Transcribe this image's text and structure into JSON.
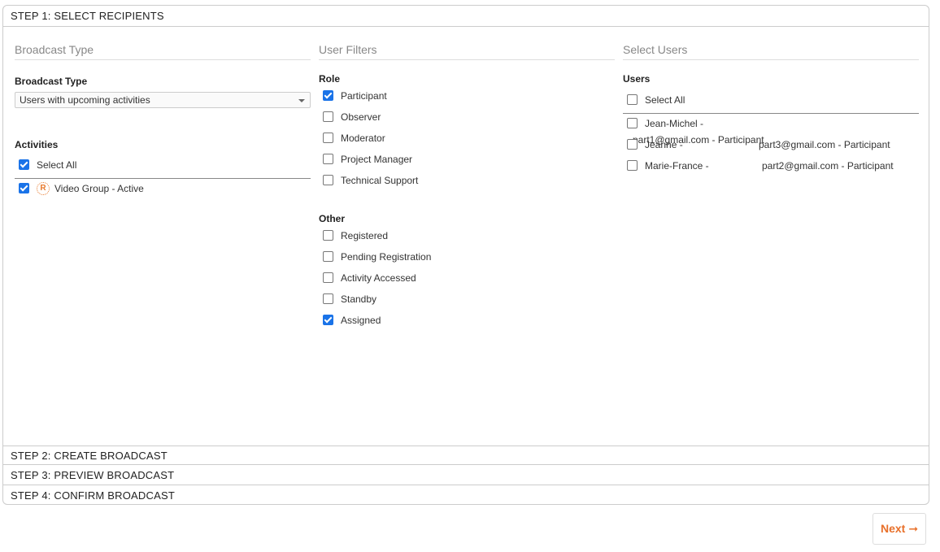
{
  "steps": {
    "step1": "STEP 1: SELECT RECIPIENTS",
    "step2": "STEP 2: CREATE BROADCAST",
    "step3": "STEP 3: PREVIEW BROADCAST",
    "step4": "STEP 4: CONFIRM BROADCAST"
  },
  "broadcast": {
    "section_title": "Broadcast Type",
    "label": "Broadcast Type",
    "selected": "Users with upcoming activities",
    "activities_label": "Activities",
    "select_all": "Select All",
    "activity_item": "Video Group - Active"
  },
  "filters": {
    "section_title": "User Filters",
    "role_label": "Role",
    "roles": [
      "Participant",
      "Observer",
      "Moderator",
      "Project Manager",
      "Technical Support"
    ],
    "other_label": "Other",
    "others": [
      "Registered",
      "Pending Registration",
      "Activity Accessed",
      "Standby",
      "Assigned"
    ]
  },
  "users": {
    "section_title": "Select Users",
    "label": "Users",
    "select_all": "Select All",
    "list": [
      {
        "name": "Jean-Michel -",
        "email": "part1@gmail.com - Participant"
      },
      {
        "name": "Jeanne -",
        "email": "part3@gmail.com - Participant"
      },
      {
        "name": "Marie-France -",
        "email": "part2@gmail.com - Participant"
      }
    ]
  },
  "actions": {
    "next": "Next",
    "next_icon": "arrow-right-icon"
  },
  "colors": {
    "accent": "#e8702a",
    "checkbox": "#1a73e8"
  }
}
